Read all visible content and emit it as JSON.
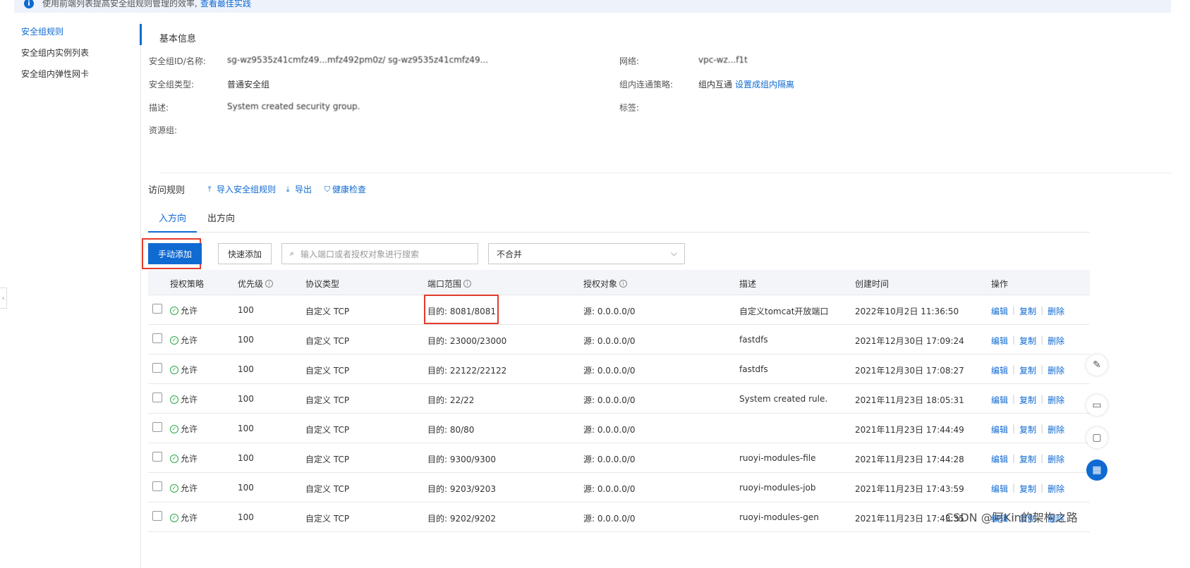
{
  "banner": {
    "icon": "info-icon",
    "text": "使用前端列表提高安全组规则管理的效率,",
    "link": "查看最佳实践"
  },
  "sidebar": {
    "items": [
      {
        "label": "安全组规则",
        "active": true
      },
      {
        "label": "安全组内实例列表",
        "active": false
      },
      {
        "label": "安全组内弹性网卡",
        "active": false
      }
    ]
  },
  "basic_info": {
    "title": "基本信息",
    "fields": {
      "id_label": "安全组ID/名称:",
      "id_value": "sg-wz9535z41cmfz49...mfz492pm0z/ sg-wz9535z41cmfz49...",
      "type_label": "安全组类型:",
      "type_value": "普通安全组",
      "desc_label": "描述:",
      "desc_value": "System created security group.",
      "rg_label": "资源组:",
      "network_label": "网络:",
      "network_value": "vpc-wz...f1t",
      "policy_label": "组内连通策略:",
      "policy_value": "组内互通",
      "policy_link": "设置成组内隔离",
      "tag_label": "标签:"
    }
  },
  "rules": {
    "title": "访问规则",
    "actions": [
      {
        "icon": "upload-icon",
        "label": "导入安全组规则"
      },
      {
        "icon": "download-icon",
        "label": "导出"
      },
      {
        "icon": "shield-check-icon",
        "label": "健康检查"
      }
    ],
    "tabs": [
      {
        "label": "入方向",
        "active": true
      },
      {
        "label": "出方向",
        "active": false
      }
    ],
    "toolbar": {
      "manual_add": "手动添加",
      "quick_add": "快速添加",
      "search_placeholder": "输入端口或者授权对象进行搜索",
      "merge_select": "不合并"
    },
    "columns": [
      "授权策略",
      "优先级",
      "协议类型",
      "端口范围",
      "授权对象",
      "描述",
      "创建时间",
      "操作"
    ],
    "rows": [
      {
        "policy": "允许",
        "priority": "100",
        "protocol": "自定义 TCP",
        "port": "目的: 8081/8081",
        "source": "源: 0.0.0.0/0",
        "desc": "自定义tomcat开放端口",
        "created": "2022年10月2日 11:36:50"
      },
      {
        "policy": "允许",
        "priority": "100",
        "protocol": "自定义 TCP",
        "port": "目的: 23000/23000",
        "source": "源: 0.0.0.0/0",
        "desc": "fastdfs",
        "created": "2021年12月30日 17:09:24"
      },
      {
        "policy": "允许",
        "priority": "100",
        "protocol": "自定义 TCP",
        "port": "目的: 22122/22122",
        "source": "源: 0.0.0.0/0",
        "desc": "fastdfs",
        "created": "2021年12月30日 17:08:27"
      },
      {
        "policy": "允许",
        "priority": "100",
        "protocol": "自定义 TCP",
        "port": "目的: 22/22",
        "source": "源: 0.0.0.0/0",
        "desc": "System created rule.",
        "created": "2021年11月23日 18:05:31"
      },
      {
        "policy": "允许",
        "priority": "100",
        "protocol": "自定义 TCP",
        "port": "目的: 80/80",
        "source": "源: 0.0.0.0/0",
        "desc": "",
        "created": "2021年11月23日 17:44:49"
      },
      {
        "policy": "允许",
        "priority": "100",
        "protocol": "自定义 TCP",
        "port": "目的: 9300/9300",
        "source": "源: 0.0.0.0/0",
        "desc": "ruoyi-modules-file",
        "created": "2021年11月23日 17:44:28"
      },
      {
        "policy": "允许",
        "priority": "100",
        "protocol": "自定义 TCP",
        "port": "目的: 9203/9203",
        "source": "源: 0.0.0.0/0",
        "desc": "ruoyi-modules-job",
        "created": "2021年11月23日 17:43:59"
      },
      {
        "policy": "允许",
        "priority": "100",
        "protocol": "自定义 TCP",
        "port": "目的: 9202/9202",
        "source": "源: 0.0.0.0/0",
        "desc": "ruoyi-modules-gen",
        "created": "2021年11月23日 17:43:35"
      }
    ],
    "row_ops": [
      "编辑",
      "复制",
      "删除"
    ]
  },
  "float_buttons": [
    "edit-icon",
    "book-icon",
    "chat-icon",
    "apps-icon"
  ],
  "watermark": "CSDN @阿Kin的架构之路",
  "colors": {
    "accent": "#0f6ad2",
    "highlight_box": "#e23b2e",
    "allow_green": "#2aa845"
  }
}
